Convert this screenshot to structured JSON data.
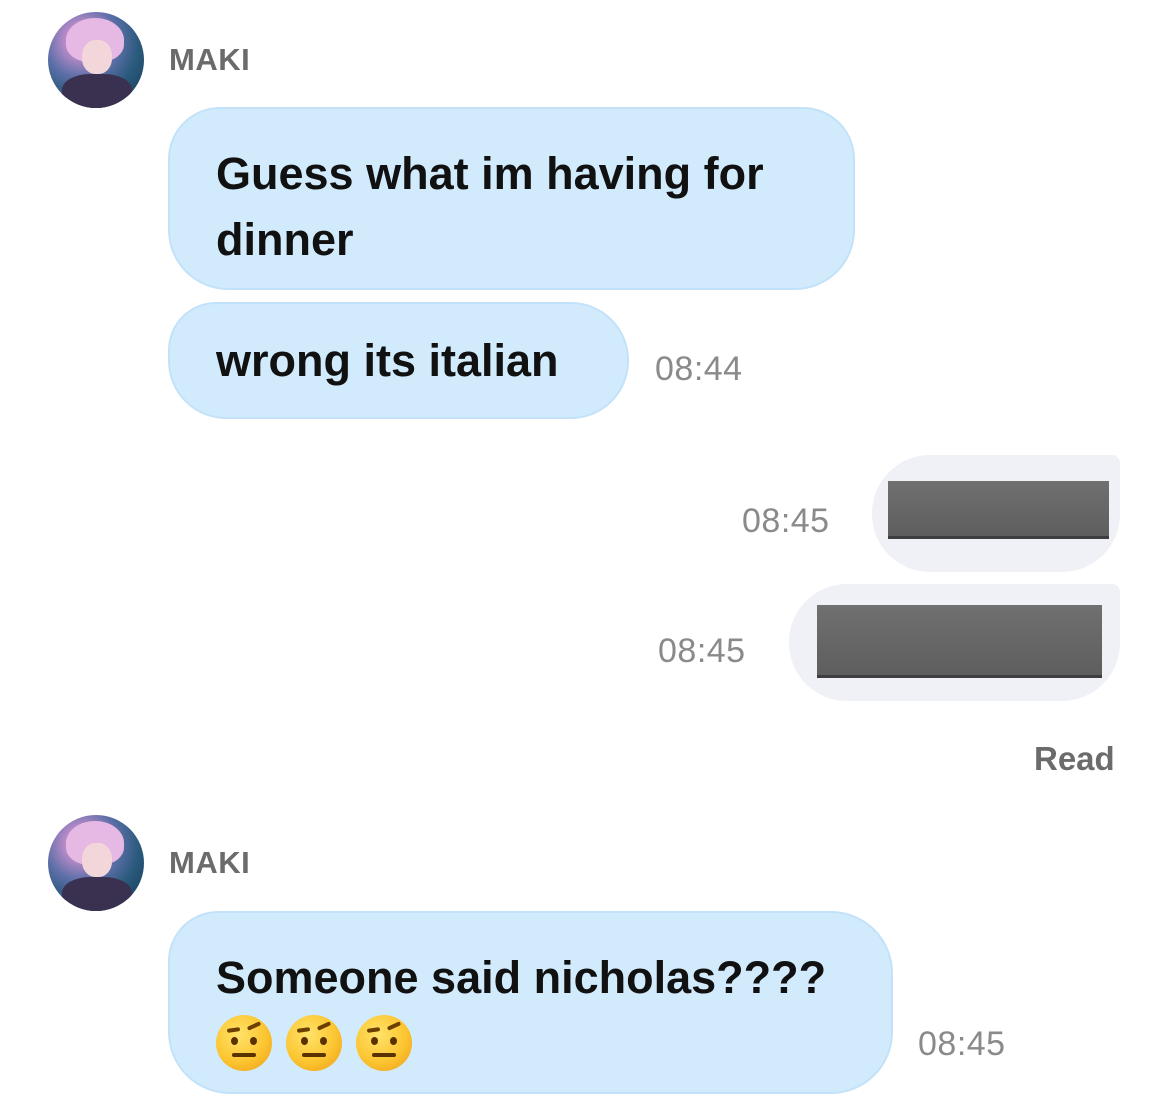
{
  "groups": [
    {
      "sender": "MAKI",
      "messages": [
        {
          "text": "Guess what im having for dinner",
          "time": ""
        },
        {
          "text": "wrong its italian",
          "time": "08:44"
        }
      ]
    },
    {
      "sender": "MAKI",
      "messages": [
        {
          "text": "Someone said nicholas????",
          "emoji": [
            "face-with-raised-eyebrow",
            "face-with-raised-eyebrow",
            "face-with-raised-eyebrow"
          ],
          "time": "08:45"
        }
      ]
    }
  ],
  "outgoing": [
    {
      "content": "redacted",
      "time": "08:45"
    },
    {
      "content": "redacted",
      "time": "08:45"
    }
  ],
  "read_receipt": "Read",
  "colors": {
    "incoming_bubble": "#d1ebfd",
    "outgoing_bubble": "#f0f1f6",
    "timestamp": "#8a8a8a",
    "name": "#6b6b6b"
  }
}
